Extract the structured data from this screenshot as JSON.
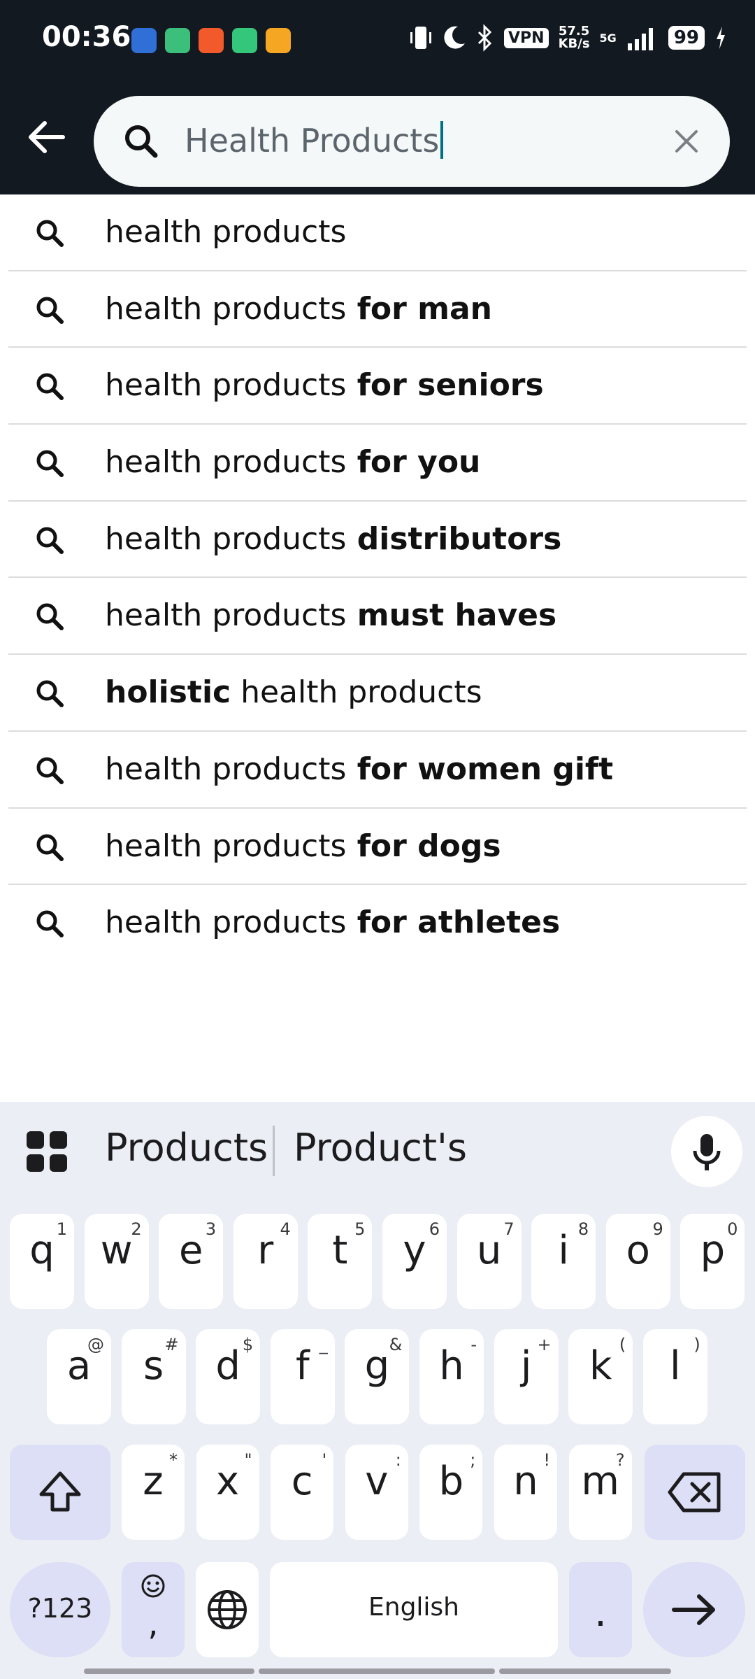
{
  "status_bar": {
    "time": "00:36",
    "vpn": "VPN",
    "speed_value": "57.5",
    "speed_unit": "KB/s",
    "network": "5G",
    "battery": "99"
  },
  "search": {
    "value": "Health Products"
  },
  "suggestions": [
    {
      "pre": "health products",
      "bold": " for man",
      "post": ""
    },
    {
      "pre": "health products",
      "bold": " for seniors",
      "post": ""
    },
    {
      "pre": "health products",
      "bold": " for you",
      "post": ""
    },
    {
      "pre": "health products",
      "bold": " distributors",
      "post": ""
    },
    {
      "pre": "health products",
      "bold": " must haves",
      "post": ""
    },
    {
      "pre": "",
      "bold": "holistic",
      "post": " health products"
    },
    {
      "pre": "health products",
      "bold": " for women gift",
      "post": ""
    },
    {
      "pre": "health products",
      "bold": " for dogs",
      "post": ""
    },
    {
      "pre": "health products",
      "bold": " for athletes",
      "post": ""
    }
  ],
  "first_suggestion": "health products",
  "keyboard": {
    "predictions": [
      "Products",
      "Product's"
    ],
    "row1": [
      [
        "q",
        "1"
      ],
      [
        "w",
        "2"
      ],
      [
        "e",
        "3"
      ],
      [
        "r",
        "4"
      ],
      [
        "t",
        "5"
      ],
      [
        "y",
        "6"
      ],
      [
        "u",
        "7"
      ],
      [
        "i",
        "8"
      ],
      [
        "o",
        "9"
      ],
      [
        "p",
        "0"
      ]
    ],
    "row2": [
      [
        "a",
        "@"
      ],
      [
        "s",
        "#"
      ],
      [
        "d",
        "$"
      ],
      [
        "f",
        "_"
      ],
      [
        "g",
        "&"
      ],
      [
        "h",
        "-"
      ],
      [
        "j",
        "+"
      ],
      [
        "k",
        "("
      ],
      [
        "l",
        ")"
      ]
    ],
    "row3": [
      [
        "z",
        "*"
      ],
      [
        "x",
        "\""
      ],
      [
        "c",
        "'"
      ],
      [
        "v",
        ":"
      ],
      [
        "b",
        ";"
      ],
      [
        "n",
        "!"
      ],
      [
        "m",
        "?"
      ]
    ],
    "symbols_label": "?123",
    "comma": ",",
    "space_label": "English",
    "period": "."
  }
}
